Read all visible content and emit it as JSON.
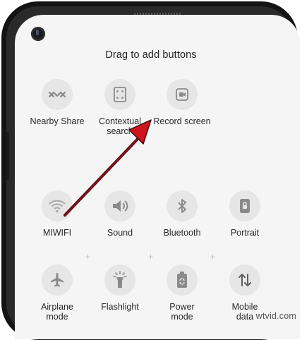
{
  "header": {
    "title": "Drag to add buttons"
  },
  "available_tiles": [
    {
      "label": "Nearby Share",
      "icon": "nearby-share-icon"
    },
    {
      "label": "Contextual\nsearch",
      "icon": "contextual-search-icon"
    },
    {
      "label": "Record screen",
      "icon": "record-screen-icon"
    }
  ],
  "active_tiles": [
    {
      "label": "MIWIFI",
      "icon": "wifi-icon"
    },
    {
      "label": "Sound",
      "icon": "sound-icon"
    },
    {
      "label": "Bluetooth",
      "icon": "bluetooth-icon"
    },
    {
      "label": "Portrait",
      "icon": "portrait-lock-icon"
    },
    {
      "label": "Airplane\nmode",
      "icon": "airplane-icon"
    },
    {
      "label": "Flashlight",
      "icon": "flashlight-icon"
    },
    {
      "label": "Power\nmode",
      "icon": "battery-icon"
    },
    {
      "label": "Mobile\ndata",
      "icon": "mobile-data-icon"
    }
  ],
  "plus_marker": "+",
  "watermark": "wtvid.com",
  "colors": {
    "tile_bg": "#e6e6e6",
    "icon": "#8a8a8a",
    "arrow": "#b0121b"
  }
}
